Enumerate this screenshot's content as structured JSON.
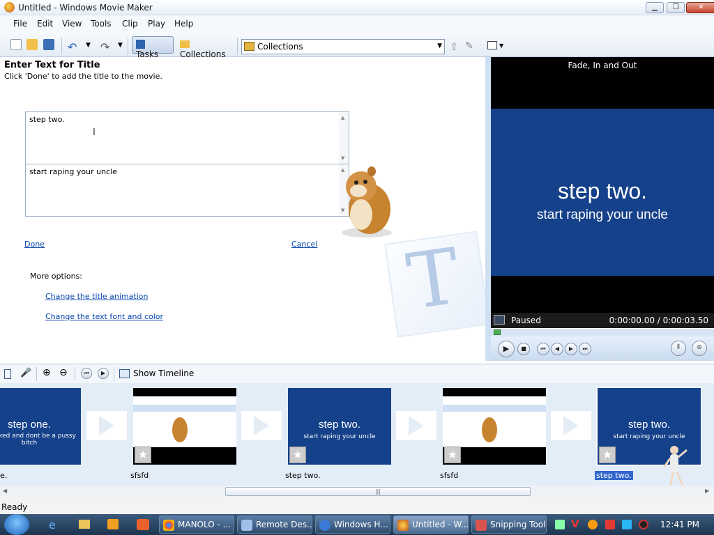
{
  "window": {
    "title": "Untitled - Windows Movie Maker"
  },
  "menu": [
    "File",
    "Edit",
    "View",
    "Tools",
    "Clip",
    "Play",
    "Help"
  ],
  "toolbar": {
    "tasks_label": "Tasks",
    "collections_label": "Collections",
    "collections_select": "Collections"
  },
  "title_editor": {
    "heading": "Enter Text for Title",
    "instruction": "Click 'Done' to add the title to the movie.",
    "text1": "step two.",
    "text2": "start raping your uncle",
    "done": "Done",
    "cancel": "Cancel",
    "more_options": "More options:",
    "link_animation": "Change the title animation",
    "link_font": "Change the text font and color"
  },
  "preview": {
    "title": "Fade, In and Out",
    "line1": "step two.",
    "line2": "start raping your uncle",
    "status": "Paused",
    "time": "0:00:00.00 / 0:00:03.50"
  },
  "storyboard": {
    "show_timeline": "Show Timeline",
    "clips": [
      {
        "type": "title",
        "line1": "step one.",
        "line2": "et naked and dont be a pussy bitch",
        "label": "e."
      },
      {
        "type": "video",
        "label": "sfsfd"
      },
      {
        "type": "title",
        "line1": "step two.",
        "line2": "start raping your uncle",
        "label": "step two."
      },
      {
        "type": "video",
        "label": "sfsfd"
      },
      {
        "type": "title",
        "line1": "step two.",
        "line2": "start raping your uncle",
        "label": "step two."
      }
    ]
  },
  "status": {
    "text": "Ready"
  },
  "taskbar": {
    "items": [
      "MANOLO - ...",
      "Remote Des...",
      "Windows H...",
      "Untitled - W...",
      "Snipping Tool"
    ],
    "clock": "12:41 PM"
  }
}
